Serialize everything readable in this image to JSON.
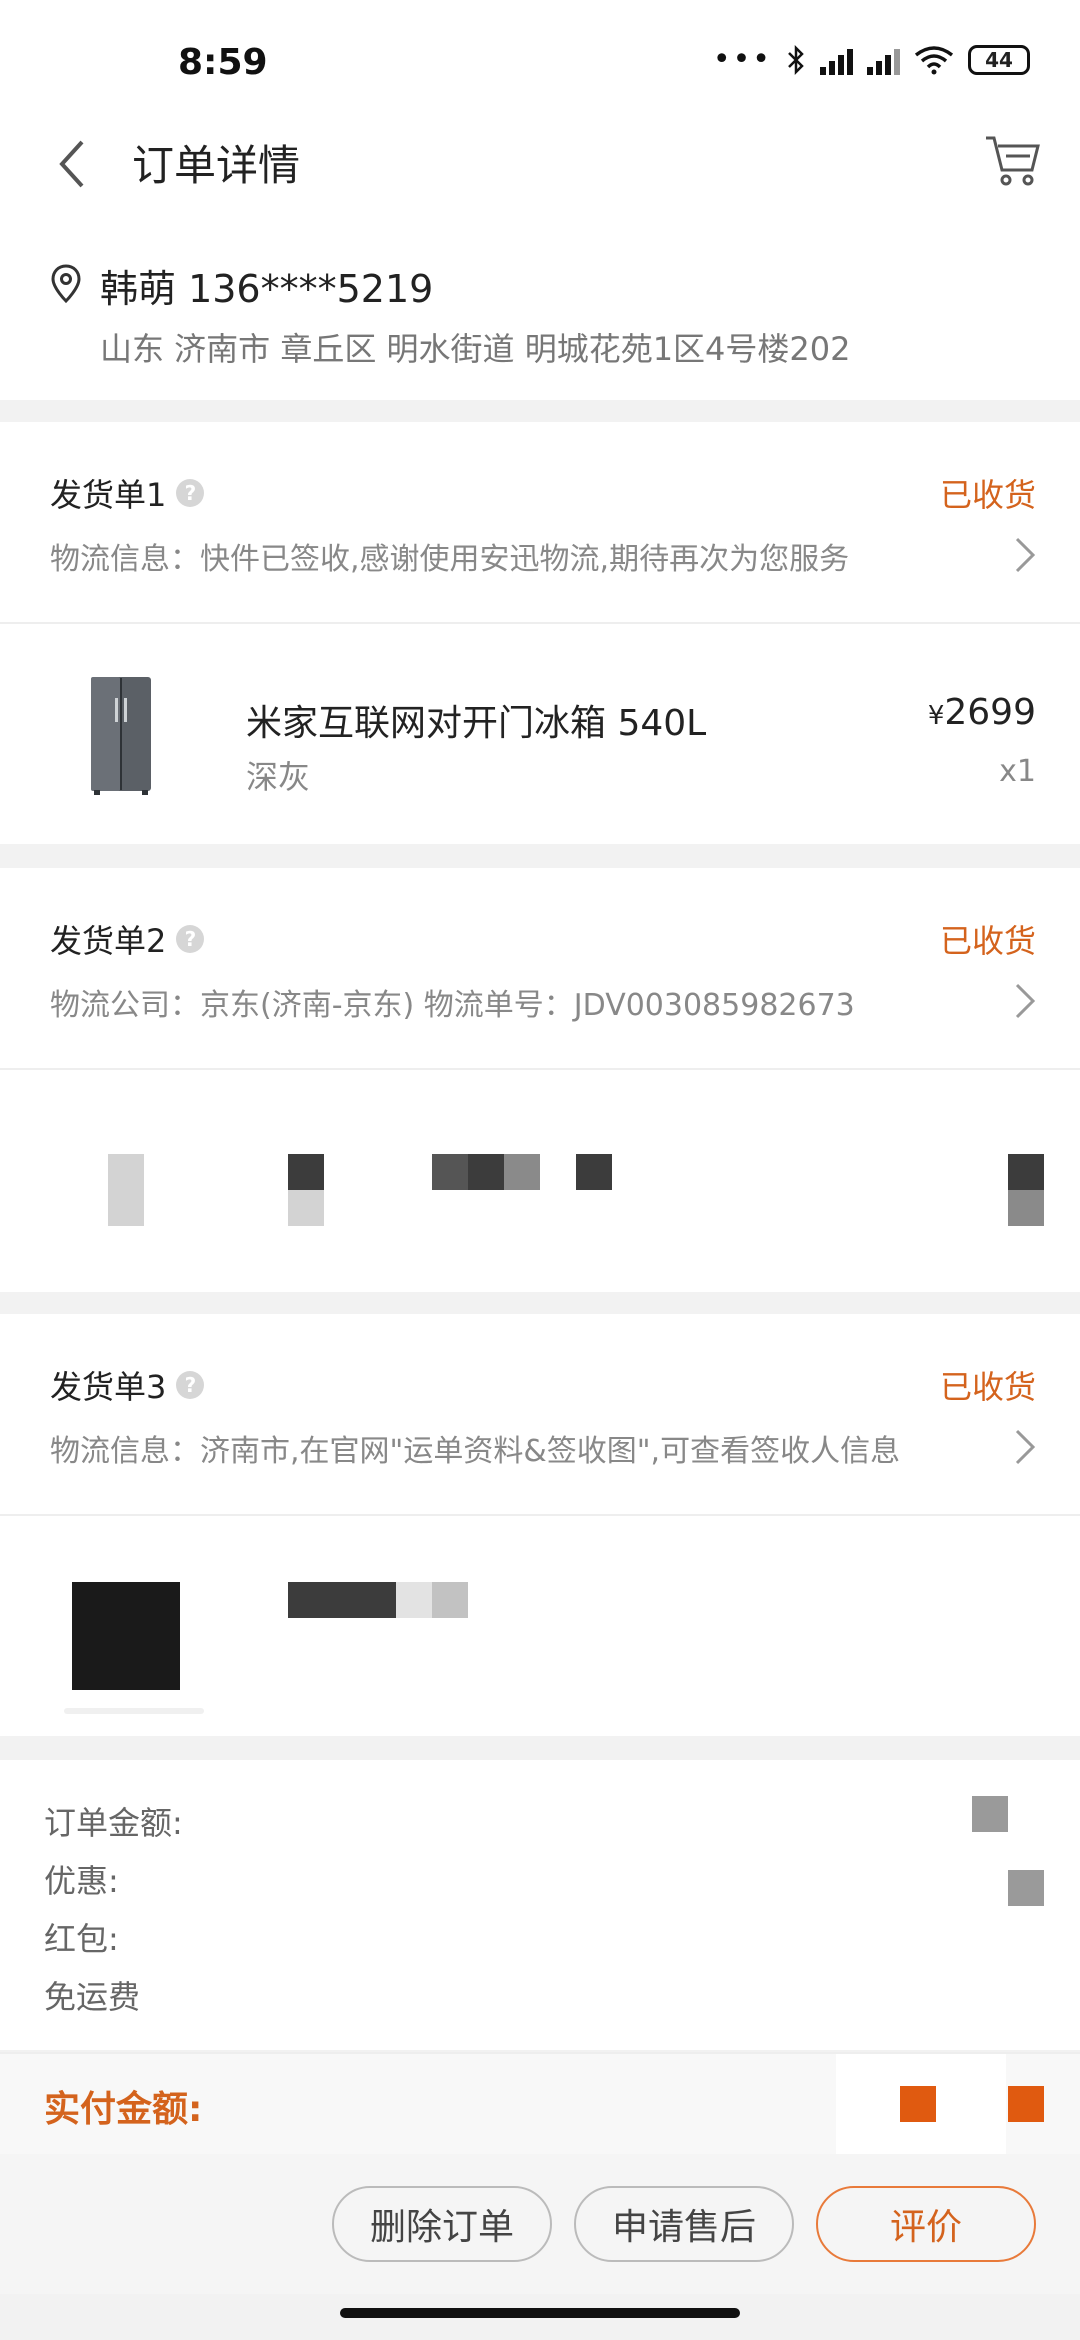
{
  "status_bar": {
    "time": "8:59",
    "dots": "•••",
    "battery": "44"
  },
  "header": {
    "title": "订单详情"
  },
  "address": {
    "name_phone": "韩萌 136****5219",
    "line": "山东 济南市 章丘区 明水街道 明城花苑1区4号楼202"
  },
  "shipments": [
    {
      "title": "发货单1",
      "status": "已收货",
      "info": "物流信息：快件已签收,感谢使用安迅物流,期待再次为您服务",
      "product": {
        "name": "米家互联网对开门冰箱 540L",
        "variant": "深灰",
        "currency": "¥",
        "price": "2699",
        "qty": "x1"
      }
    },
    {
      "title": "发货单2",
      "status": "已收货",
      "info": "物流公司：京东(济南-京东)   物流单号：JDV003085982673"
    },
    {
      "title": "发货单3",
      "status": "已收货",
      "info": "物流信息：济南市,在官网\"运单资料&签收图\",可查看签收人信息"
    }
  ],
  "summary": {
    "order_amount_label": "订单金额:",
    "discount_label": "优惠:",
    "red_packet_label": "红包:",
    "free_shipping_label": "免运费"
  },
  "payment": {
    "label": "实付金额:"
  },
  "actions": {
    "delete": "删除订单",
    "after_sale": "申请售后",
    "review": "评价"
  },
  "colors": {
    "accent": "#d4631d",
    "pay_block": "#e05a10"
  }
}
